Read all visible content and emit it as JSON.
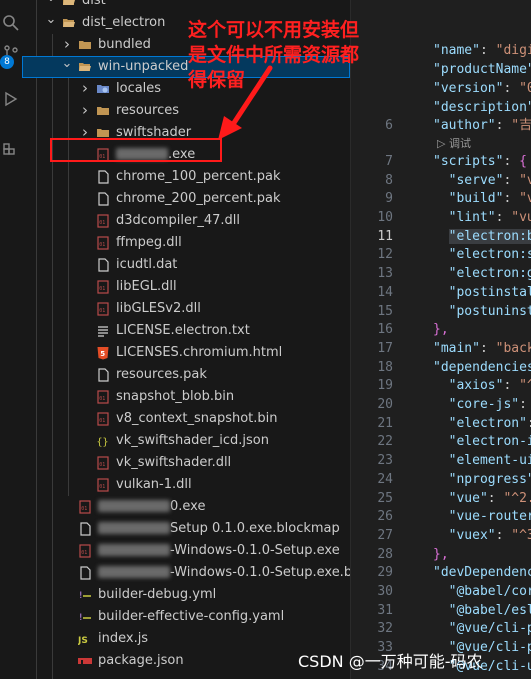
{
  "explorer": {
    "items": [
      {
        "label": "dist",
        "type": "folder-open",
        "depth": 1
      },
      {
        "label": "dist_electron",
        "type": "folder-open",
        "depth": 1
      },
      {
        "label": "bundled",
        "type": "folder",
        "depth": 2
      },
      {
        "label": "win-unpacked",
        "type": "folder-open",
        "depth": 2,
        "selected": true
      },
      {
        "label": "locales",
        "type": "folder-special",
        "depth": 3
      },
      {
        "label": "resources",
        "type": "folder",
        "depth": 3
      },
      {
        "label": "swiftshader",
        "type": "folder",
        "depth": 3
      },
      {
        "label": ".exe",
        "type": "binary",
        "depth": 3,
        "redacted": true
      },
      {
        "label": "chrome_100_percent.pak",
        "type": "file",
        "depth": 3
      },
      {
        "label": "chrome_200_percent.pak",
        "type": "file",
        "depth": 3
      },
      {
        "label": "d3dcompiler_47.dll",
        "type": "binary",
        "depth": 3
      },
      {
        "label": "ffmpeg.dll",
        "type": "binary",
        "depth": 3
      },
      {
        "label": "icudtl.dat",
        "type": "file",
        "depth": 3
      },
      {
        "label": "libEGL.dll",
        "type": "binary",
        "depth": 3
      },
      {
        "label": "libGLESv2.dll",
        "type": "binary",
        "depth": 3
      },
      {
        "label": "LICENSE.electron.txt",
        "type": "text",
        "depth": 3
      },
      {
        "label": "LICENSES.chromium.html",
        "type": "html",
        "depth": 3
      },
      {
        "label": "resources.pak",
        "type": "file",
        "depth": 3
      },
      {
        "label": "snapshot_blob.bin",
        "type": "binary",
        "depth": 3
      },
      {
        "label": "v8_context_snapshot.bin",
        "type": "binary",
        "depth": 3
      },
      {
        "label": "vk_swiftshader_icd.json",
        "type": "json",
        "depth": 3
      },
      {
        "label": "vk_swiftshader.dll",
        "type": "binary",
        "depth": 3
      },
      {
        "label": "vulkan-1.dll",
        "type": "binary",
        "depth": 3
      },
      {
        "label": "0.exe",
        "type": "binary",
        "depth": 2,
        "redacted": true
      },
      {
        "label": "Setup 0.1.0.exe.blockmap",
        "type": "file",
        "depth": 2,
        "redacted": true
      },
      {
        "label": "-Windows-0.1.0-Setup.exe",
        "type": "binary",
        "depth": 2,
        "redacted": true
      },
      {
        "label": "-Windows-0.1.0-Setup.exe.blockmap",
        "type": "file",
        "depth": 2,
        "redacted": true
      },
      {
        "label": "builder-debug.yml",
        "type": "yaml",
        "depth": 2
      },
      {
        "label": "builder-effective-config.yaml",
        "type": "yaml",
        "depth": 2
      },
      {
        "label": "index.js",
        "type": "js",
        "depth": 2
      },
      {
        "label": "package.json",
        "type": "npm",
        "depth": 2
      }
    ]
  },
  "annotation": {
    "text": "这个可以不用安装但是文件中所需资源都得保留"
  },
  "activity_bar": {
    "badge_count": "8"
  },
  "editor": {
    "codelens": "▷ 调试",
    "lines": [
      {
        "n": "",
        "code": ""
      },
      {
        "n": "",
        "code": ""
      },
      {
        "n": "",
        "code": "\"name\": \"digi"
      },
      {
        "n": "",
        "code": "\"productName\""
      },
      {
        "n": "",
        "code": "\"version\": \"0"
      },
      {
        "n": "",
        "code": "\"description\""
      },
      {
        "n": "6",
        "code": "\"author\": \"吉"
      },
      {
        "n": "7",
        "code": "\"scripts\": {"
      },
      {
        "n": "8",
        "code": "  \"serve\": \"v"
      },
      {
        "n": "9",
        "code": "  \"build\": \"v"
      },
      {
        "n": "10",
        "code": "  \"lint\": \"vu"
      },
      {
        "n": "11",
        "code": "  \"electron:b"
      },
      {
        "n": "12",
        "code": "  \"electron:s"
      },
      {
        "n": "13",
        "code": "  \"electron:g"
      },
      {
        "n": "14",
        "code": "  \"postinstal"
      },
      {
        "n": "15",
        "code": "  \"postuninst"
      },
      {
        "n": "16",
        "code": "},"
      },
      {
        "n": "17",
        "code": "\"main\": \"back"
      },
      {
        "n": "18",
        "code": "\"dependencies"
      },
      {
        "n": "19",
        "code": "  \"axios\": \"^"
      },
      {
        "n": "20",
        "code": "  \"core-js\":"
      },
      {
        "n": "21",
        "code": "  \"electron\":"
      },
      {
        "n": "22",
        "code": "  \"electron-i"
      },
      {
        "n": "23",
        "code": "  \"element-ui"
      },
      {
        "n": "24",
        "code": "  \"nprogress\""
      },
      {
        "n": "25",
        "code": "  \"vue\": \"^2."
      },
      {
        "n": "26",
        "code": "  \"vue-router"
      },
      {
        "n": "27",
        "code": "  \"vuex\": \"^3"
      },
      {
        "n": "28",
        "code": "},"
      },
      {
        "n": "29",
        "code": "\"devDependenc"
      },
      {
        "n": "30",
        "code": "  \"@babel/cor"
      },
      {
        "n": "31",
        "code": "  \"@babel/esl"
      },
      {
        "n": "32",
        "code": "  \"@vue/cli-p"
      },
      {
        "n": "33",
        "code": "  \"@vue/cli-p"
      },
      {
        "n": "34",
        "code": "  \"@vue/cli-u"
      }
    ]
  },
  "watermark": "CSDN @一万种可能-码农"
}
